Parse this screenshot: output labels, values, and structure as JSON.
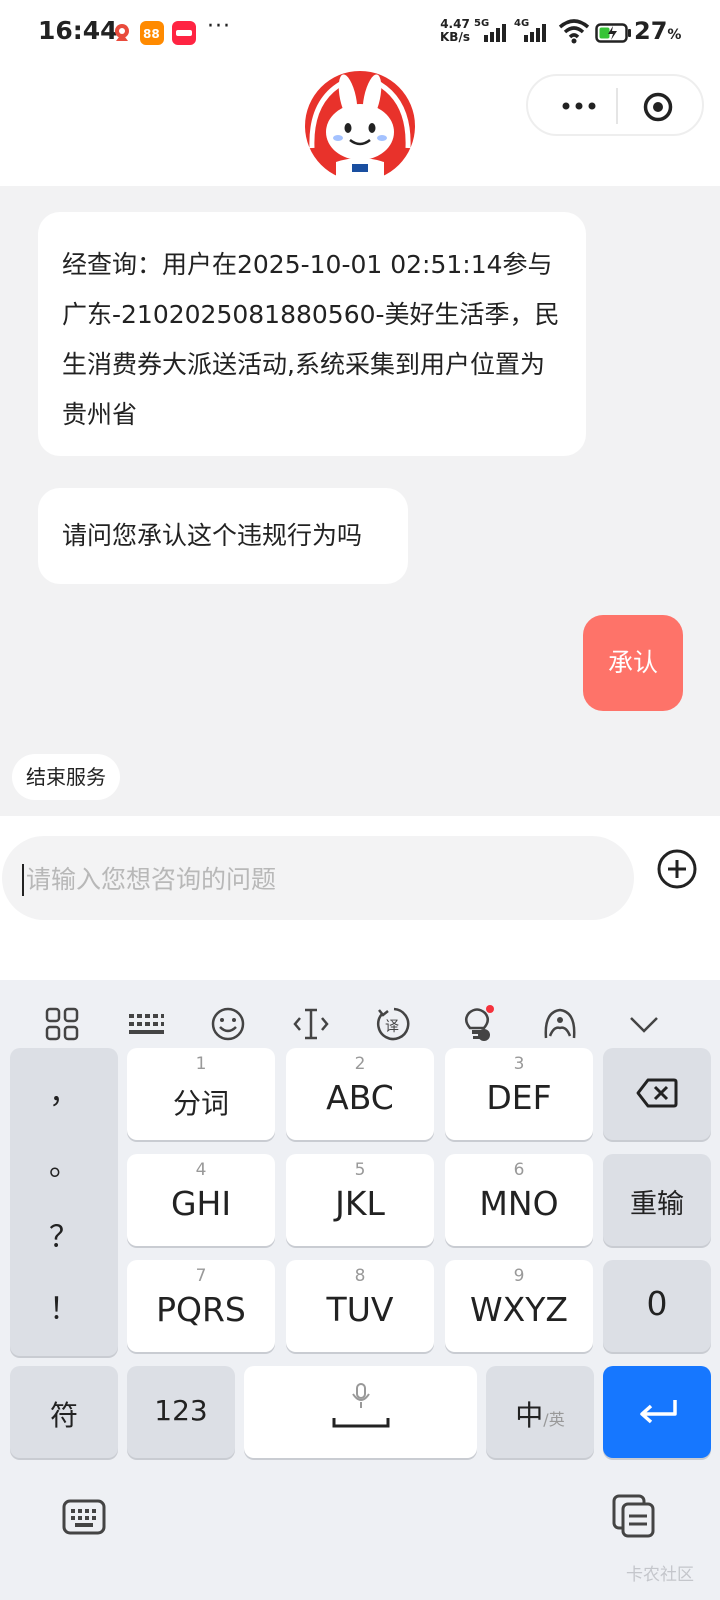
{
  "status_bar": {
    "time": "16:44",
    "more": "···",
    "speed_value": "4.47",
    "speed_unit": "KB/s",
    "net1": "5G",
    "net2": "4G",
    "battery_percent": "27",
    "battery_unit": "%"
  },
  "header": {
    "avatar_icon": "rabbit-mascot-icon",
    "menu_icon": "more-dots-icon",
    "close_icon": "close-circle-icon"
  },
  "chat": {
    "bot_message_1": "经查询：用户在2025-10-01 02:51:14参与广东-2102025081880560-美好生活季，民生消费券大派送活动,系统采集到用户位置为贵州省",
    "bot_message_2": "请问您承认这个违规行为吗",
    "user_message": "承认",
    "end_service": "结束服务"
  },
  "input": {
    "placeholder": "请输入您想咨询的问题",
    "plus_icon": "plus-circle-icon"
  },
  "keyboard": {
    "toolbar_icons": [
      "grid-icon",
      "keyboard-icon",
      "emoji-icon",
      "cursor-icon",
      "translate-icon",
      "bulb-ai-icon",
      "mascot-icon",
      "chevron-down-icon"
    ],
    "punctuation": [
      "，",
      "。",
      "？",
      "！"
    ],
    "keys": [
      {
        "num": "1",
        "label": "分词"
      },
      {
        "num": "2",
        "label": "ABC"
      },
      {
        "num": "3",
        "label": "DEF"
      },
      {
        "num": "4",
        "label": "GHI"
      },
      {
        "num": "5",
        "label": "JKL"
      },
      {
        "num": "6",
        "label": "MNO"
      },
      {
        "num": "7",
        "label": "PQRS"
      },
      {
        "num": "8",
        "label": "TUV"
      },
      {
        "num": "9",
        "label": "WXYZ"
      }
    ],
    "retype": "重输",
    "zero": "0",
    "symbols": "符",
    "numbers": "123",
    "lang_main": "中",
    "lang_alt": "/英",
    "accent": "#1677ff",
    "watermark": "卡农社区"
  },
  "colors": {
    "user_bubble": "#fe7369",
    "mascot_red": "#e8322b"
  }
}
